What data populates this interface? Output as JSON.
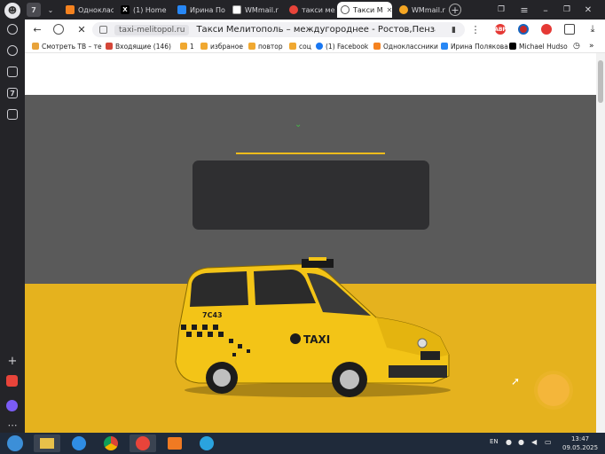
{
  "browser": {
    "tab_count": "7",
    "tabs": [
      {
        "label": "Одноклас",
        "color": "#f5821f",
        "glyph": "ok"
      },
      {
        "label": "(1) Home",
        "color": "#000000",
        "glyph": "X"
      },
      {
        "label": "Ирина По",
        "color": "#2787f5",
        "glyph": "vk"
      },
      {
        "label": "WMmail.r",
        "color": "#555555",
        "glyph": "W"
      },
      {
        "label": "такси мел",
        "color": "#e8443a",
        "glyph": "Я"
      },
      {
        "label": "Такси М",
        "color": "#777777",
        "glyph": "o"
      },
      {
        "label": "WMmail.r",
        "color": "#f5a623",
        "glyph": "W"
      }
    ],
    "domain": "taxi-melitopol.ru",
    "page_title": "Такси Мелитополь – междугороднее - Ростов,Пенза,Крас...",
    "ext_badges": [
      "ABP",
      "",
      "",
      ""
    ]
  },
  "bookmarks": [
    {
      "label": "Смотреть ТВ – те",
      "color": "#e8a33a"
    },
    {
      "label": "Входящие (146)",
      "color": "#d44638"
    },
    {
      "label": "1",
      "color": "#f0a830"
    },
    {
      "label": "избраное",
      "color": "#f0a830"
    },
    {
      "label": "повтор",
      "color": "#f0a830"
    },
    {
      "label": "соц",
      "color": "#f0a830"
    },
    {
      "label": "(1) Facebook",
      "color": "#1877f2"
    },
    {
      "label": "Одноклассники",
      "color": "#f5821f"
    },
    {
      "label": "Ирина Полякова",
      "color": "#2787f5"
    },
    {
      "label": "Michael Hudso",
      "color": "#000000"
    }
  ],
  "page": {
    "gray_color": "#5a5a5a",
    "yellow_color": "#e5b21e",
    "taxi_sign": "TAXI",
    "taxi_number": "7C43"
  },
  "taskbar": {
    "lang": "EN",
    "time": "13:47",
    "date": "09.05.2025"
  }
}
